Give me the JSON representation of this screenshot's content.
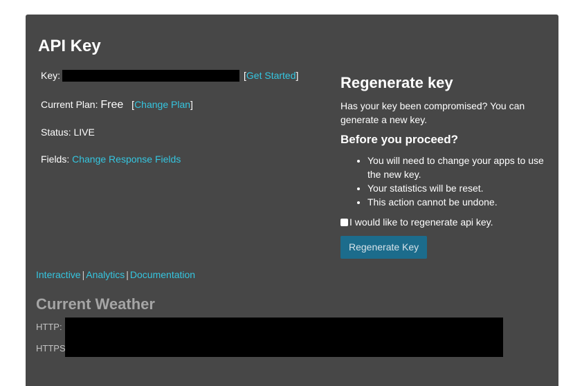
{
  "title": "API Key",
  "key": {
    "label": "Key:",
    "get_started": "Get Started"
  },
  "plan": {
    "label": "Current Plan:",
    "value": "Free",
    "change_plan": "Change Plan"
  },
  "status": {
    "label": "Status:",
    "value": "LIVE"
  },
  "fields": {
    "label": "Fields:",
    "change_fields": "Change Response Fields"
  },
  "regenerate": {
    "title": "Regenerate key",
    "description": "Has your key been compromised? You can generate a new key.",
    "proceed_title": "Before you proceed?",
    "bullets": [
      "You will need to change your apps to use the new key.",
      "Your statistics will be reset.",
      "This action cannot be undone."
    ],
    "confirm_label": "I would like to regenerate api key.",
    "button_label": "Regenerate Key"
  },
  "links": {
    "interactive": "Interactive",
    "analytics": "Analytics",
    "documentation": "Documentation",
    "separator": "|"
  },
  "weather": {
    "title": "Current Weather",
    "http_label": "HTTP:",
    "https_label": "HTTPS"
  },
  "colors": {
    "panel": "#474747",
    "link": "#35c6e0",
    "button": "#1c6c8c"
  }
}
